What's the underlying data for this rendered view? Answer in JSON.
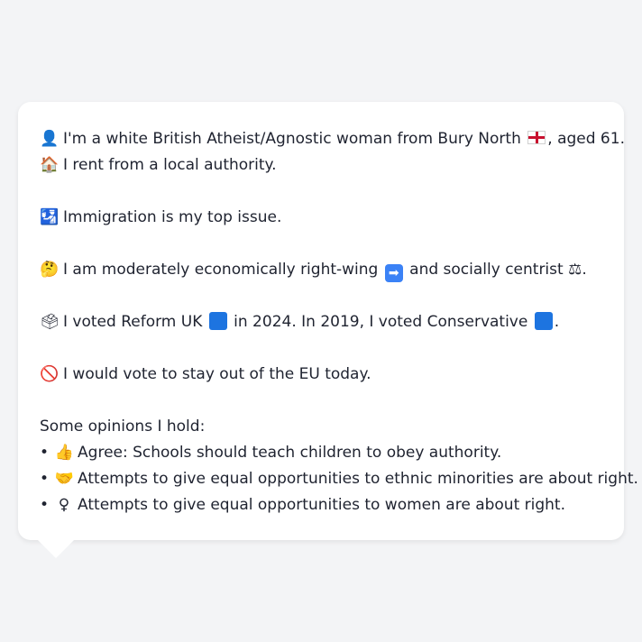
{
  "colors": {
    "background": "#f3f4f6",
    "bubble": "#ffffff",
    "text": "#1f2330",
    "reform": "#1d74e0",
    "conservative": "#1d74e0"
  },
  "profile": {
    "identity": {
      "icon": "person-silhouette-icon",
      "glyph": "👤",
      "text_before": "I'm a white British Atheist/Agnostic woman from Bury North",
      "flag_icon": "england-flag-icon",
      "text_after": ", aged 61."
    },
    "housing": {
      "icon": "house-icon",
      "glyph": "🏠",
      "text": "I rent from a local authority."
    },
    "top_issue": {
      "icon": "passport-control-icon",
      "glyph": "🛂",
      "text": "Immigration is my top issue."
    },
    "ideology": {
      "icon": "thinking-face-icon",
      "glyph": "🤔",
      "text_before": "I am moderately economically right-wing",
      "econ_icon": "right-arrow-icon",
      "econ_glyph": "➡",
      "text_middle": "and socially centrist",
      "social_icon": "balance-scale-icon",
      "social_glyph": "⚖",
      "text_after": "."
    },
    "votes": {
      "icon": "ballot-box-icon",
      "glyph": "🗳",
      "text_1": "I voted Reform UK",
      "text_2": "in 2024. In 2019, I voted Conservative",
      "text_3": "."
    },
    "eu": {
      "icon": "no-entry-icon",
      "glyph": "🚫",
      "text": "I would vote to stay out of the EU today."
    }
  },
  "opinions": {
    "heading": "Some opinions I hold:",
    "bullet": "•",
    "items": [
      {
        "icon": "thumbs-up-icon",
        "glyph": "👍",
        "text": "Agree: Schools should teach children to obey authority."
      },
      {
        "icon": "handshake-icon",
        "glyph": "🤝",
        "text": "Attempts to give equal opportunities to ethnic minorities are about right."
      },
      {
        "icon": "female-sign-icon",
        "glyph": "♀",
        "text": "Attempts to give equal opportunities to women are about right."
      }
    ]
  }
}
